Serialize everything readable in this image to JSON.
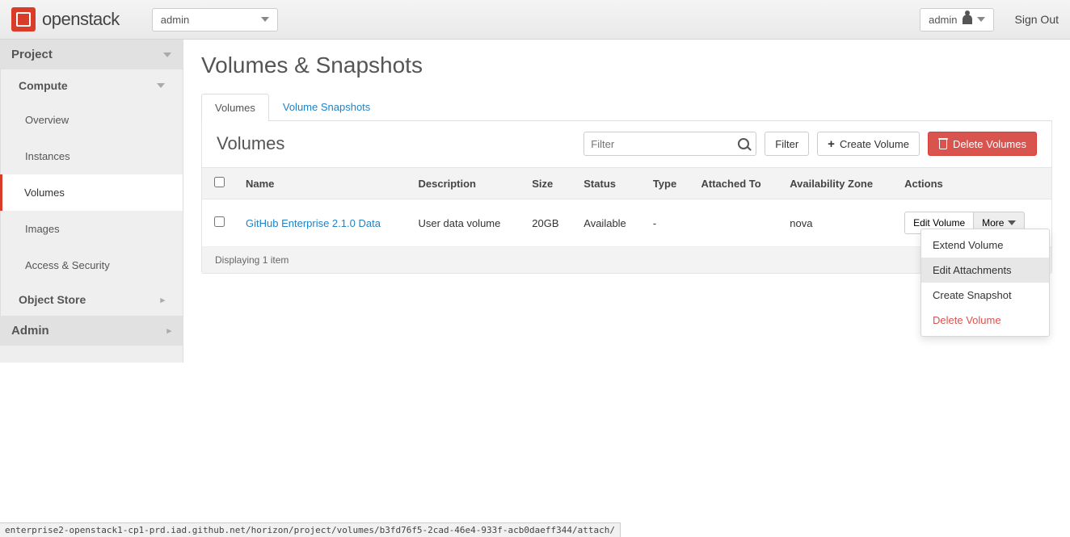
{
  "brand": "openstack",
  "project_switcher": "admin",
  "user_switcher": "admin",
  "sign_out": "Sign Out",
  "sidebar": {
    "project": "Project",
    "compute": "Compute",
    "items": [
      "Overview",
      "Instances",
      "Volumes",
      "Images",
      "Access & Security"
    ],
    "active_index": 2,
    "object_store": "Object Store",
    "admin": "Admin"
  },
  "page_title": "Volumes & Snapshots",
  "tabs": {
    "volumes": "Volumes",
    "snapshots": "Volume Snapshots",
    "active": "volumes"
  },
  "panel": {
    "title": "Volumes",
    "filter_placeholder": "Filter",
    "filter_btn": "Filter",
    "create_btn": "Create Volume",
    "delete_btn": "Delete Volumes"
  },
  "table": {
    "headers": {
      "name": "Name",
      "description": "Description",
      "size": "Size",
      "status": "Status",
      "type": "Type",
      "attached": "Attached To",
      "az": "Availability Zone",
      "actions": "Actions"
    },
    "rows": [
      {
        "name": "GitHub Enterprise 2.1.0 Data",
        "description": "User data volume",
        "size": "20GB",
        "status": "Available",
        "type": "-",
        "attached": "",
        "az": "nova",
        "edit_label": "Edit Volume",
        "more_label": "More"
      }
    ],
    "footer": "Displaying 1 item"
  },
  "dropdown": {
    "extend": "Extend Volume",
    "edit_attach": "Edit Attachments",
    "create_snap": "Create Snapshot",
    "delete": "Delete Volume"
  },
  "status_url": "enterprise2-openstack1-cp1-prd.iad.github.net/horizon/project/volumes/b3fd76f5-2cad-46e4-933f-acb0daeff344/attach/"
}
